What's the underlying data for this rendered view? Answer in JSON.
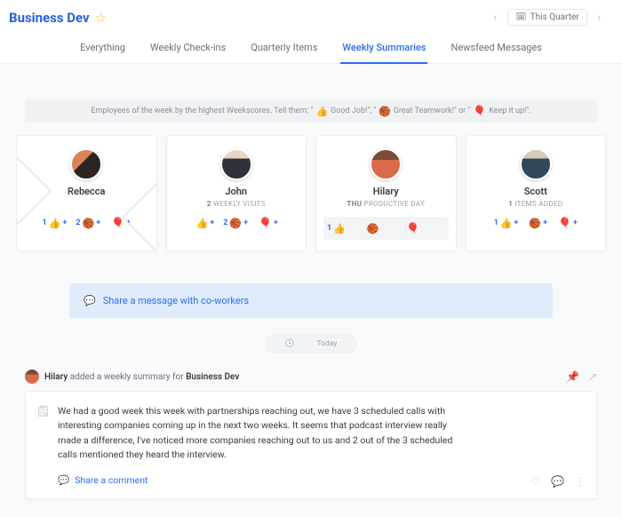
{
  "header": {
    "title": "Business Dev",
    "period_label": "This Quarter"
  },
  "tabs": [
    {
      "label": "Everything",
      "active": false
    },
    {
      "label": "Weekly Check-ins",
      "active": false
    },
    {
      "label": "Quarterly Items",
      "active": false
    },
    {
      "label": "Weekly Summaries",
      "active": true
    },
    {
      "label": "Newsfeed Messages",
      "active": false
    }
  ],
  "hint": {
    "prefix": "Employees of the week by the highest Weekscores. Tell them: \"",
    "r1_icon": "👍",
    "r1_text": "Good Job!\", \"",
    "r2_icon": "🏀",
    "r2_text": "Great Teamwork!\" or \"",
    "r3_icon": "🎈",
    "r3_text": "Keep it up!\"."
  },
  "cards": [
    {
      "name": "Rebecca",
      "subtitle_bold": "",
      "subtitle_rest": "",
      "reactions": [
        {
          "count": "1",
          "icon": "👍",
          "plus": "+"
        },
        {
          "count": "2",
          "icon": "🏀",
          "plus": "+"
        },
        {
          "count": "",
          "icon": "🎈",
          "plus": "+"
        }
      ]
    },
    {
      "name": "John",
      "subtitle_bold": "2",
      "subtitle_rest": " WEEKLY VISITS",
      "reactions": [
        {
          "count": "",
          "icon": "👍",
          "plus": "+"
        },
        {
          "count": "2",
          "icon": "🏀",
          "plus": "+"
        },
        {
          "count": "",
          "icon": "🎈",
          "plus": "+"
        }
      ]
    },
    {
      "name": "Hilary",
      "subtitle_bold": "THU",
      "subtitle_rest": " PRODUCTIVE DAY",
      "reactions": [
        {
          "count": "1",
          "icon": "👍",
          "plus": ""
        },
        {
          "count": "",
          "icon": "🏀",
          "plus": ""
        },
        {
          "count": "",
          "icon": "🎈",
          "plus": ""
        }
      ]
    },
    {
      "name": "Scott",
      "subtitle_bold": "1",
      "subtitle_rest": " ITEMS ADDED",
      "reactions": [
        {
          "count": "1",
          "icon": "👍",
          "plus": "+"
        },
        {
          "count": "",
          "icon": "🏀",
          "plus": "+"
        },
        {
          "count": "",
          "icon": "🎈",
          "plus": "+"
        }
      ]
    }
  ],
  "share_placeholder": "Share a message with co-workers",
  "today_label": "Today",
  "feed": {
    "author": "Hilary",
    "verb": " added a weekly summary for ",
    "target": "Business Dev",
    "body": "We had a good week this week with partnerships reaching out, we have 3 scheduled calls with interesting companies coming up in the next two weeks. It seems that podcast interview really made a difference, I've noticed more companies reaching out to us and 2 out of the 3 scheduled calls mentioned they heard the interview.",
    "share_comment": "Share a comment"
  }
}
